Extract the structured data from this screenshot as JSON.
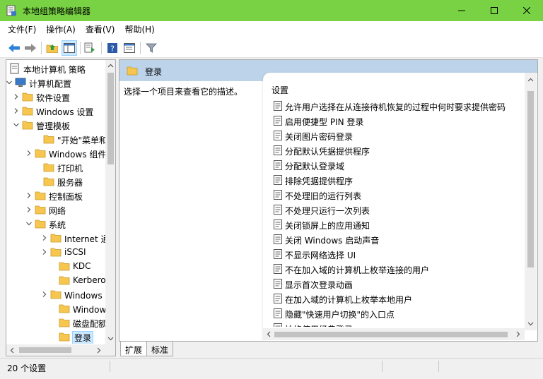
{
  "window": {
    "title": "本地组策略编辑器",
    "title_bar_color": "#78d243"
  },
  "menu": [
    {
      "label": "文件(F)"
    },
    {
      "label": "操作(A)"
    },
    {
      "label": "查看(V)"
    },
    {
      "label": "帮助(H)"
    }
  ],
  "toolbar": {
    "icons": [
      "back-arrow-icon",
      "forward-arrow-icon",
      "up-folder-icon",
      "show-hide-tree-icon",
      "export-list-icon",
      "help-icon",
      "properties-icon",
      "filter-icon"
    ]
  },
  "tree": {
    "items": [
      {
        "label": "本地计算机 策略",
        "icon": "computer-policy-icon",
        "twisty": "none"
      },
      {
        "label": "计算机配置",
        "icon": "computer-icon",
        "twisty": "expanded"
      },
      {
        "label": "软件设置",
        "icon": "folder-icon",
        "twisty": "collapsed"
      },
      {
        "label": "Windows 设置",
        "icon": "folder-icon",
        "twisty": "collapsed"
      },
      {
        "label": "管理模板",
        "icon": "folder-icon",
        "twisty": "expanded"
      },
      {
        "label": "\"开始\"菜单和任务栏",
        "icon": "folder-icon",
        "twisty": "none"
      },
      {
        "label": "Windows 组件",
        "icon": "folder-icon",
        "twisty": "collapsed"
      },
      {
        "label": "打印机",
        "icon": "folder-icon",
        "twisty": "none"
      },
      {
        "label": "服务器",
        "icon": "folder-icon",
        "twisty": "none"
      },
      {
        "label": "控制面板",
        "icon": "folder-icon",
        "twisty": "collapsed"
      },
      {
        "label": "网络",
        "icon": "folder-icon",
        "twisty": "collapsed"
      },
      {
        "label": "系统",
        "icon": "folder-icon",
        "twisty": "expanded"
      },
      {
        "label": "Internet 通信管理",
        "icon": "folder-icon",
        "twisty": "collapsed"
      },
      {
        "label": "iSCSI",
        "icon": "folder-icon",
        "twisty": "collapsed"
      },
      {
        "label": "KDC",
        "icon": "folder-icon",
        "twisty": "none"
      },
      {
        "label": "Kerberos",
        "icon": "folder-icon",
        "twisty": "none"
      },
      {
        "label": "Windows 时间服务",
        "icon": "folder-icon",
        "twisty": "collapsed"
      },
      {
        "label": "Windows 文件保护",
        "icon": "folder-icon",
        "twisty": "none"
      },
      {
        "label": "磁盘配额",
        "icon": "folder-icon",
        "twisty": "none"
      },
      {
        "label": "登录",
        "icon": "folder-icon",
        "twisty": "none",
        "selected": true
      }
    ]
  },
  "right": {
    "header_title": "登录",
    "description": "选择一个项目来查看它的描述。",
    "list_header": "设置",
    "settings": [
      {
        "label": "允许用户选择在从连接待机恢复的过程中何时要求提供密码"
      },
      {
        "label": "启用便捷型 PIN 登录"
      },
      {
        "label": "关闭图片密码登录"
      },
      {
        "label": "分配默认凭据提供程序"
      },
      {
        "label": "分配默认登录域"
      },
      {
        "label": "排除凭据提供程序"
      },
      {
        "label": "不处理旧的运行列表"
      },
      {
        "label": "不处理只运行一次列表"
      },
      {
        "label": "关闭锁屏上的应用通知"
      },
      {
        "label": "关闭 Windows 启动声音"
      },
      {
        "label": "不显示网络选择 UI"
      },
      {
        "label": "不在加入域的计算机上枚举连接的用户"
      },
      {
        "label": "显示首次登录动画"
      },
      {
        "label": "在加入域的计算机上枚举本地用户"
      },
      {
        "label": "隐藏\"快速用户切换\"的入口点"
      },
      {
        "label": "始终使用经典登录"
      }
    ]
  },
  "tabs": [
    {
      "label": "扩展",
      "active": true
    },
    {
      "label": "标准",
      "active": false
    }
  ],
  "status": {
    "text": "20 个设置"
  },
  "colors": {
    "header_bg": "#bcd3e9",
    "selection_bg": "#cce8ff",
    "folder": "#f7c64f"
  }
}
